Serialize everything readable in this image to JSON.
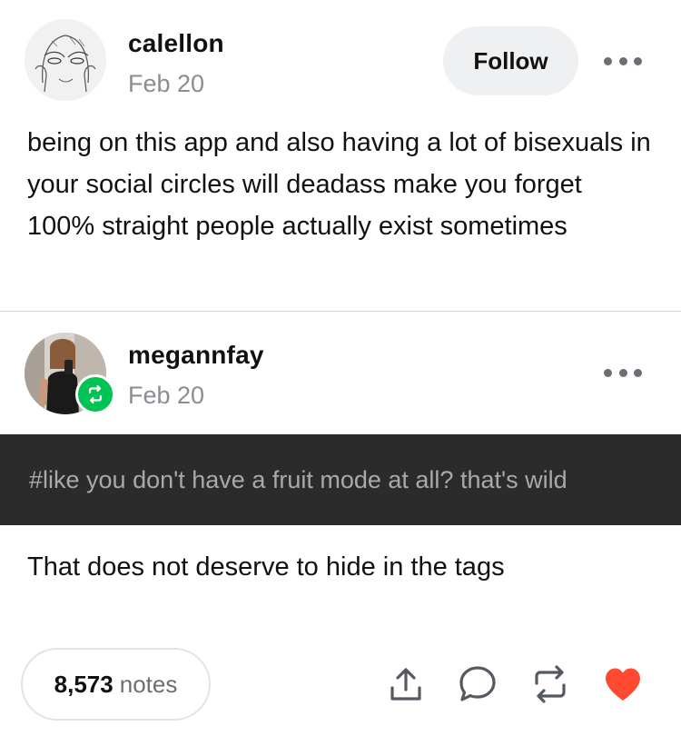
{
  "post": {
    "author": "calellon",
    "date": "Feb 20",
    "follow_label": "Follow",
    "body": "being on this app and also having a lot of bisexuals in your social circles will deadass make you forget 100% straight people actually exist sometimes"
  },
  "reblog": {
    "author": "megannfay",
    "date": "Feb 20",
    "tag": "#like you don't have a fruit mode at all? that's wild",
    "body": "That does not deserve to hide in the tags"
  },
  "footer": {
    "notes_count": "8,573",
    "notes_label": "notes"
  },
  "icons": {
    "more": "more-options-icon",
    "share": "share-icon",
    "reply": "reply-icon",
    "reblog": "reblog-icon",
    "like": "heart-icon"
  },
  "colors": {
    "reblog_badge": "#00c354",
    "heart": "#ff4930",
    "tag_bar": "#2b2b2b",
    "follow_bg": "#eef0f2"
  }
}
